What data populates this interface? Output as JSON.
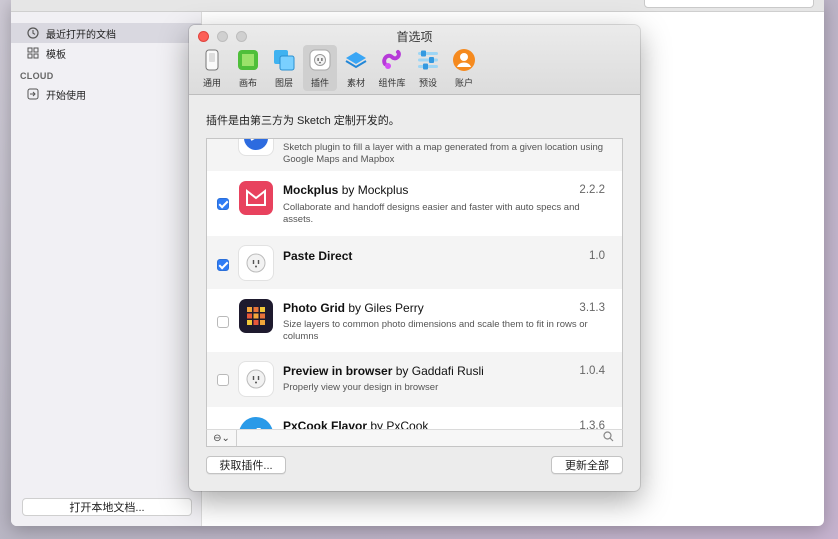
{
  "sidebar": {
    "items": [
      {
        "label": "最近打开的文档",
        "icon": "clock-icon"
      },
      {
        "label": "模板",
        "icon": "grid-icon"
      }
    ],
    "section_heading": "CLOUD",
    "cloud_items": [
      {
        "label": "开始使用",
        "icon": "arrow-in-icon"
      }
    ],
    "open_local_label": "打开本地文档..."
  },
  "prefs": {
    "title": "首选项",
    "tabs": [
      {
        "label": "通用",
        "icon": "phone-icon"
      },
      {
        "label": "画布",
        "icon": "canvas-icon"
      },
      {
        "label": "图层",
        "icon": "layers-icon"
      },
      {
        "label": "插件",
        "icon": "plug-icon",
        "active": true
      },
      {
        "label": "素材",
        "icon": "assets-icon"
      },
      {
        "label": "组件库",
        "icon": "library-icon"
      },
      {
        "label": "预设",
        "icon": "presets-icon"
      },
      {
        "label": "账户",
        "icon": "account-icon"
      }
    ],
    "description": "插件是由第三方为 Sketch 定制开发的。",
    "plugins": [
      {
        "name": "",
        "author": "",
        "version": "",
        "checked": true,
        "description": "Sketch plugin to fill a layer with a map generated from a given location using Google Maps and Mapbox"
      },
      {
        "name": "Mockplus",
        "author": "by Mockplus",
        "version": "2.2.2",
        "checked": true,
        "description": "Collaborate and handoff designs easier and faster with auto specs and assets."
      },
      {
        "name": "Paste Direct",
        "author": "",
        "version": "1.0",
        "checked": true,
        "description": ""
      },
      {
        "name": "Photo Grid",
        "author": "by Giles Perry",
        "version": "3.1.3",
        "checked": false,
        "description": "Size layers to common photo dimensions and scale them to fit in rows or columns"
      },
      {
        "name": "Preview in browser",
        "author": "by Gaddafi Rusli",
        "version": "1.0.4",
        "checked": false,
        "description": "Properly view your design in browser"
      },
      {
        "name": "PxCook Flavor",
        "author": "by PxCook",
        "version": "1.3.6",
        "checked": false,
        "description": ""
      }
    ],
    "filter_label": "⊖⌄",
    "get_plugins_label": "获取插件...",
    "update_all_label": "更新全部"
  },
  "colors": {
    "accent": "#2f7cf6",
    "close": "#fd5f57"
  }
}
